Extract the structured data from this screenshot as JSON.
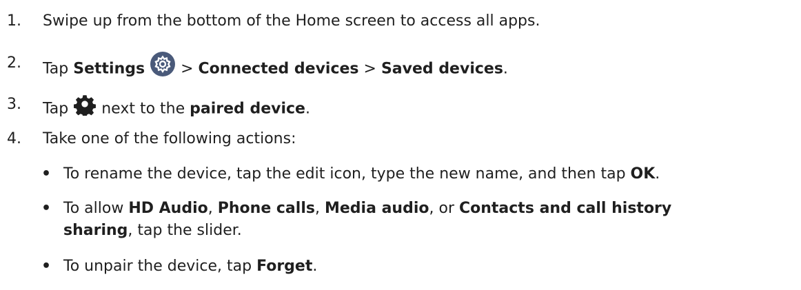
{
  "steps": [
    {
      "num": "1.",
      "parts": {
        "a": "Swipe up from the bottom of the Home screen to access all apps."
      }
    },
    {
      "num": "2.",
      "parts": {
        "a": "Tap ",
        "b1": "Settings",
        "sep1": " > ",
        "b2": "Connected devices",
        "sep2": " > ",
        "b3": "Saved devices",
        "end": "."
      }
    },
    {
      "num": "3.",
      "parts": {
        "a": "Tap ",
        "mid": " next to the ",
        "b1": "paired device",
        "end": "."
      }
    },
    {
      "num": "4.",
      "parts": {
        "a": "Take one of the following actions:"
      }
    }
  ],
  "bullets": [
    {
      "a": "To rename the device, tap the edit icon, type the new name, and then tap ",
      "b1": "OK",
      "end": "."
    },
    {
      "a": "To allow ",
      "b1": "HD Audio",
      "s1": ", ",
      "b2": "Phone calls",
      "s2": ", ",
      "b3": "Media audio",
      "s3": ", or ",
      "b4": "Contacts and call history",
      "b5": "sharing",
      "end": ", tap the slider."
    },
    {
      "a": "To unpair the device, tap ",
      "b1": "Forget",
      "end": "."
    }
  ],
  "bullet_char": "•",
  "icons": {
    "settings": "settings-app-icon",
    "gear": "gear-icon"
  },
  "colors": {
    "text": "#1f1f1f",
    "settings_icon_bg": "#4a5a7a"
  }
}
